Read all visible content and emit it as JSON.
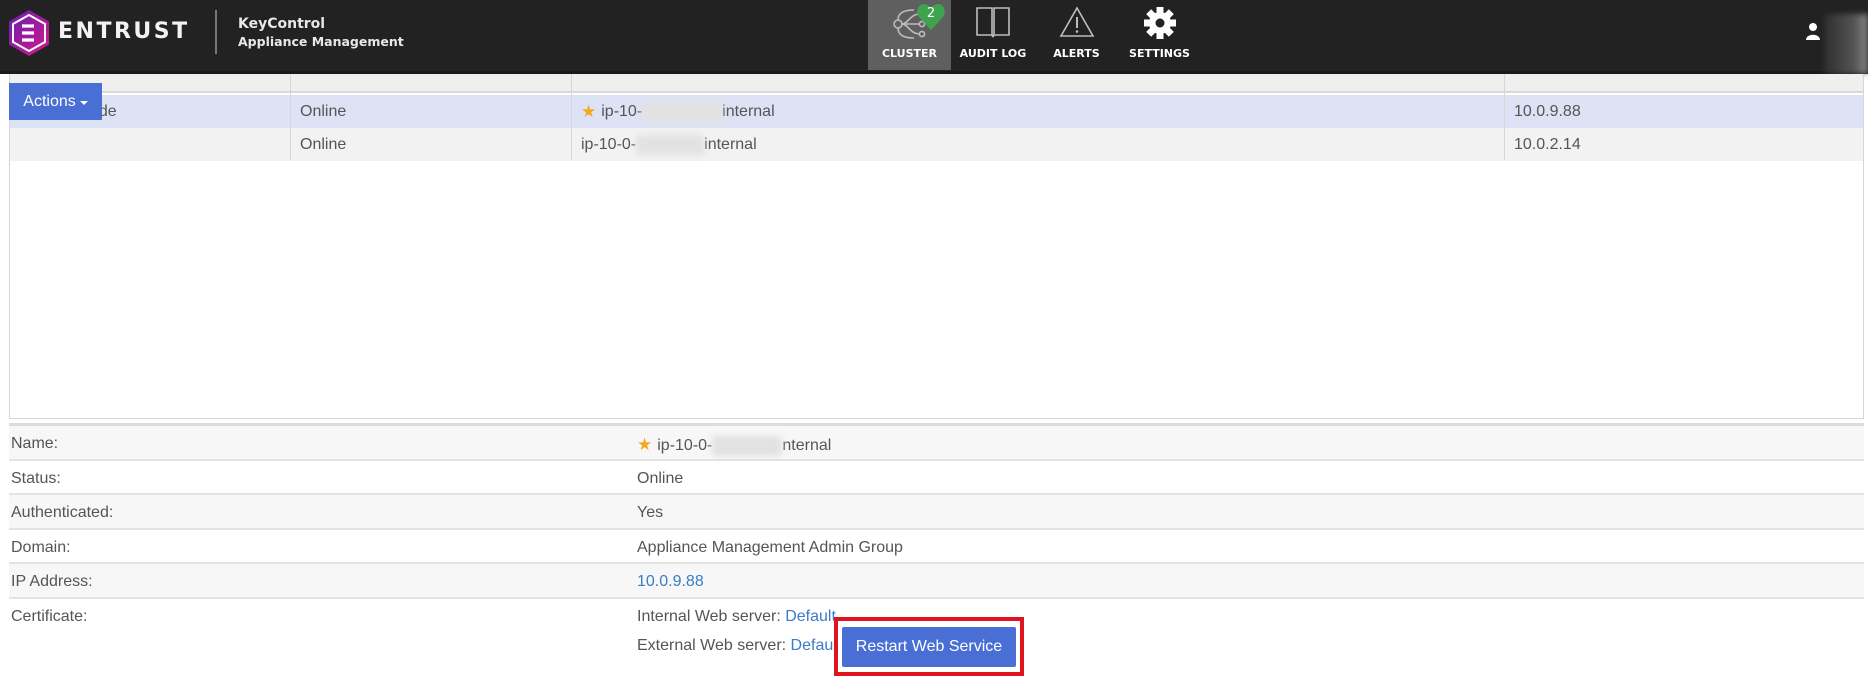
{
  "header": {
    "brand": "ENTRUST",
    "product_line1": "KeyControl",
    "product_line2": "Appliance Management",
    "nav": [
      {
        "label": "CLUSTER",
        "icon": "cluster-icon",
        "active": true,
        "badge": "2"
      },
      {
        "label": "AUDIT LOG",
        "icon": "book-icon",
        "active": false
      },
      {
        "label": "ALERTS",
        "icon": "warning-icon",
        "active": false
      },
      {
        "label": "SETTINGS",
        "icon": "gear-icon",
        "active": false
      }
    ],
    "user_icon": "user-icon"
  },
  "toolbar": {
    "actions_label": "Actions"
  },
  "nodes_table": {
    "rows": [
      {
        "role_partial": "ode",
        "status": "Online",
        "name_prefix": "ip-10-",
        "name_suffix": "internal",
        "is_primary": true,
        "ip": "10.0.9.88",
        "selected": true
      },
      {
        "role_partial": "",
        "status": "Online",
        "name_prefix": "ip-10-0-",
        "name_suffix": "internal",
        "is_primary": false,
        "ip": "10.0.2.14",
        "selected": false
      }
    ]
  },
  "details": {
    "name_label": "Name:",
    "name_prefix": "ip-10-0-",
    "name_suffix": "nternal",
    "status_label": "Status:",
    "status_value": "Online",
    "authenticated_label": "Authenticated:",
    "authenticated_value": "Yes",
    "domain_label": "Domain:",
    "domain_value": "Appliance Management Admin Group",
    "ip_label": "IP Address:",
    "ip_value": "10.0.9.88",
    "certificate_label": "Certificate:",
    "internal_label": "Internal Web server: ",
    "internal_value": "Default",
    "external_label": "External Web server: ",
    "external_value": "Defaul",
    "restart_label": "Restart Web Service"
  },
  "colors": {
    "accent": "#4a6fd4",
    "highlight": "#e0141e",
    "badge": "#3fa34d",
    "star": "#f5a623"
  }
}
